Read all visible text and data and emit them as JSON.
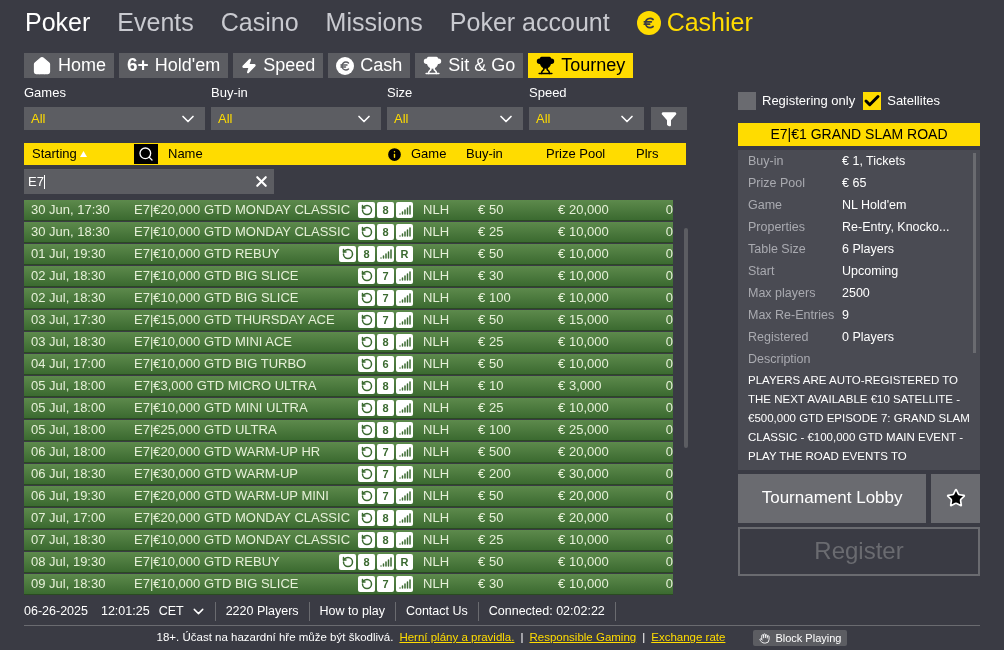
{
  "nav": [
    {
      "label": "Poker",
      "selected": true,
      "kind": "text"
    },
    {
      "label": "Events",
      "selected": false,
      "kind": "text"
    },
    {
      "label": "Casino",
      "selected": false,
      "kind": "text"
    },
    {
      "label": "Missions",
      "selected": false,
      "kind": "text"
    },
    {
      "label": "Poker account",
      "selected": false,
      "kind": "text"
    },
    {
      "label": "Cashier",
      "selected": false,
      "kind": "cashier"
    }
  ],
  "tabs": [
    {
      "label": "Home",
      "kind": "home",
      "selected": false
    },
    {
      "label": "Hold'em",
      "kind": "text",
      "icon_text": "6+",
      "selected": false
    },
    {
      "label": "Speed",
      "kind": "bolt",
      "selected": false
    },
    {
      "label": "Cash",
      "kind": "euro",
      "selected": false
    },
    {
      "label": "Sit & Go",
      "kind": "trophy",
      "selected": false
    },
    {
      "label": "Tourney",
      "kind": "cup",
      "selected": true
    }
  ],
  "filters": [
    {
      "label": "Games",
      "value": "All"
    },
    {
      "label": "Buy-in",
      "value": "All"
    },
    {
      "label": "Size",
      "value": "All"
    },
    {
      "label": "Speed",
      "value": "All"
    }
  ],
  "options": [
    {
      "label": "Registering only",
      "checked": false
    },
    {
      "label": "Satellites",
      "checked": true
    }
  ],
  "table": {
    "columns": [
      "Starting",
      "Name",
      "Game",
      "Buy-in",
      "Prize Pool",
      "Plrs"
    ],
    "search_value": "E7",
    "rows": [
      {
        "starting": "30 Jun, 17:30",
        "name": "E7|€20,000 GTD MONDAY CLASSIC",
        "size": "8",
        "game": "NLH",
        "buyin": "€ 50",
        "prize": "€ 20,000",
        "plrs": "0"
      },
      {
        "starting": "30 Jun, 18:30",
        "name": "E7|€10,000 GTD MONDAY CLASSIC",
        "size": "8",
        "game": "NLH",
        "buyin": "€ 25",
        "prize": "€ 10,000",
        "plrs": "0"
      },
      {
        "starting": "01 Jul, 19:30",
        "name": "E7|€10,000 GTD REBUY",
        "size": "8",
        "extra": "R",
        "game": "NLH",
        "buyin": "€ 50",
        "prize": "€ 10,000",
        "plrs": "0"
      },
      {
        "starting": "02 Jul, 18:30",
        "name": "E7|€10,000 GTD BIG SLICE",
        "size": "7",
        "game": "NLH",
        "buyin": "€ 30",
        "prize": "€ 10,000",
        "plrs": "0"
      },
      {
        "starting": "02 Jul, 18:30",
        "name": "E7|€10,000 GTD BIG SLICE",
        "size": "7",
        "game": "NLH",
        "buyin": "€ 100",
        "prize": "€ 10,000",
        "plrs": "0"
      },
      {
        "starting": "03 Jul, 17:30",
        "name": "E7|€15,000 GTD THURSDAY ACE",
        "size": "7",
        "game": "NLH",
        "buyin": "€ 50",
        "prize": "€ 15,000",
        "plrs": "0"
      },
      {
        "starting": "03 Jul, 18:30",
        "name": "E7|€10,000 GTD MINI ACE",
        "size": "8",
        "game": "NLH",
        "buyin": "€ 25",
        "prize": "€ 10,000",
        "plrs": "0"
      },
      {
        "starting": "04 Jul, 17:00",
        "name": "E7|€10,000 GTD BIG TURBO",
        "size": "6",
        "game": "NLH",
        "buyin": "€ 50",
        "prize": "€ 10,000",
        "plrs": "0"
      },
      {
        "starting": "05 Jul, 18:00",
        "name": "E7|€3,000 GTD MICRO ULTRA",
        "size": "8",
        "game": "NLH",
        "buyin": "€ 10",
        "prize": "€ 3,000",
        "plrs": "0"
      },
      {
        "starting": "05 Jul, 18:00",
        "name": "E7|€10,000 GTD MINI ULTRA",
        "size": "8",
        "game": "NLH",
        "buyin": "€ 25",
        "prize": "€ 10,000",
        "plrs": "0"
      },
      {
        "starting": "05 Jul, 18:00",
        "name": "E7|€25,000 GTD ULTRA",
        "size": "8",
        "game": "NLH",
        "buyin": "€ 100",
        "prize": "€ 25,000",
        "plrs": "0"
      },
      {
        "starting": "06 Jul, 18:00",
        "name": "E7|€20,000 GTD WARM-UP HR",
        "size": "7",
        "game": "NLH",
        "buyin": "€ 500",
        "prize": "€ 20,000",
        "plrs": "0"
      },
      {
        "starting": "06 Jul, 18:30",
        "name": "E7|€30,000 GTD WARM-UP",
        "size": "7",
        "game": "NLH",
        "buyin": "€ 200",
        "prize": "€ 30,000",
        "plrs": "0"
      },
      {
        "starting": "06 Jul, 19:30",
        "name": "E7|€20,000 GTD WARM-UP MINI",
        "size": "7",
        "game": "NLH",
        "buyin": "€ 50",
        "prize": "€ 20,000",
        "plrs": "0"
      },
      {
        "starting": "07 Jul, 17:00",
        "name": "E7|€20,000 GTD MONDAY CLASSIC",
        "size": "8",
        "game": "NLH",
        "buyin": "€ 50",
        "prize": "€ 20,000",
        "plrs": "0"
      },
      {
        "starting": "07 Jul, 18:30",
        "name": "E7|€10,000 GTD MONDAY CLASSIC",
        "size": "8",
        "game": "NLH",
        "buyin": "€ 25",
        "prize": "€ 10,000",
        "plrs": "0"
      },
      {
        "starting": "08 Jul, 19:30",
        "name": "E7|€10,000 GTD REBUY",
        "size": "8",
        "extra": "R",
        "game": "NLH",
        "buyin": "€ 50",
        "prize": "€ 10,000",
        "plrs": "0"
      },
      {
        "starting": "09 Jul, 18:30",
        "name": "E7|€10,000 GTD BIG SLICE",
        "size": "7",
        "game": "NLH",
        "buyin": "€ 30",
        "prize": "€ 10,000",
        "plrs": "0"
      }
    ]
  },
  "detail": {
    "title": "E7|€1 GRAND SLAM ROAD",
    "fields": [
      {
        "label": "Buy-in",
        "value": "€ 1, Tickets"
      },
      {
        "label": "Prize Pool",
        "value": "€ 65"
      },
      {
        "label": "Game",
        "value": "NL Hold'em"
      },
      {
        "label": "Properties",
        "value": "Re-Entry, Knocko..."
      },
      {
        "label": "Table Size",
        "value": "6 Players"
      },
      {
        "label": "Start",
        "value": "Upcoming"
      },
      {
        "label": "Max players",
        "value": "2500"
      },
      {
        "label": "Max Re-Entries",
        "value": "9"
      },
      {
        "label": "Registered",
        "value": "0 Players"
      }
    ],
    "description_label": "Description",
    "description": "PLAYERS ARE AUTO-REGISTERED TO THE NEXT AVAILABLE €10 SATELLITE - €500,000 GTD EPISODE 7: GRAND SLAM CLASSIC - €100,000 GTD MAIN EVENT - PLAY THE ROAD EVENTS TO",
    "lobby_button": "Tournament Lobby",
    "register_button": "Register",
    "register_disabled": true
  },
  "status_bar": {
    "date": "06-26-2025",
    "time": "12:01:25",
    "timezone": "CET",
    "players": "2220 Players",
    "links": [
      "How to play",
      "Contact Us"
    ],
    "connection": "Connected: 02:02:22"
  },
  "footer": {
    "notice": "18+. Účast na hazardní hře může být škodlivá.",
    "links": [
      "Herní plány a pravidla.",
      "Responsible Gaming",
      "Exchange rate"
    ],
    "separator": "|",
    "block_button": "Block Playing"
  }
}
